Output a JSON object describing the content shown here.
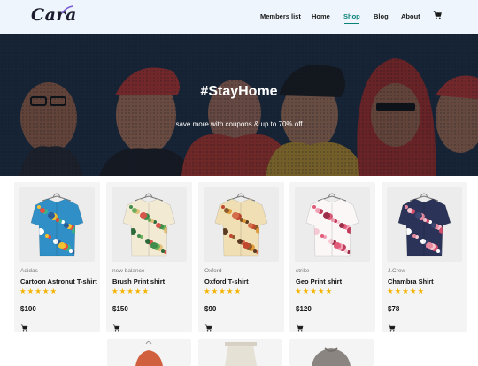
{
  "header": {
    "logo": "Cara",
    "nav": [
      "Members list",
      "Home",
      "Shop",
      "Blog",
      "About"
    ],
    "active_nav": "Shop",
    "cart_icon": "cart-icon"
  },
  "hero": {
    "title": "#StayHome",
    "subtitle": "save more with coupons & up to 70% off"
  },
  "products": [
    {
      "brand": "Adidas",
      "name": "Cartoon Astronut T-shirt",
      "rating": 5,
      "price": "$100",
      "pattern": "cartoon"
    },
    {
      "brand": "new balance",
      "name": "Brush Print shirt",
      "rating": 5,
      "price": "$150",
      "pattern": "leaf"
    },
    {
      "brand": "Oxford",
      "name": "Oxford T-shirt",
      "rating": 5,
      "price": "$90",
      "pattern": "paisley"
    },
    {
      "brand": "strike",
      "name": "Geo Print shirt",
      "rating": 5,
      "price": "$120",
      "pattern": "floral-white"
    },
    {
      "brand": "J.Crew",
      "name": "Chambra Shirt",
      "rating": 5,
      "price": "$78",
      "pattern": "floral-navy"
    }
  ],
  "colors": {
    "accent": "#088178",
    "star": "#f3b400",
    "header_bg": "#eef5fc",
    "card_bg": "#f4f4f4"
  }
}
